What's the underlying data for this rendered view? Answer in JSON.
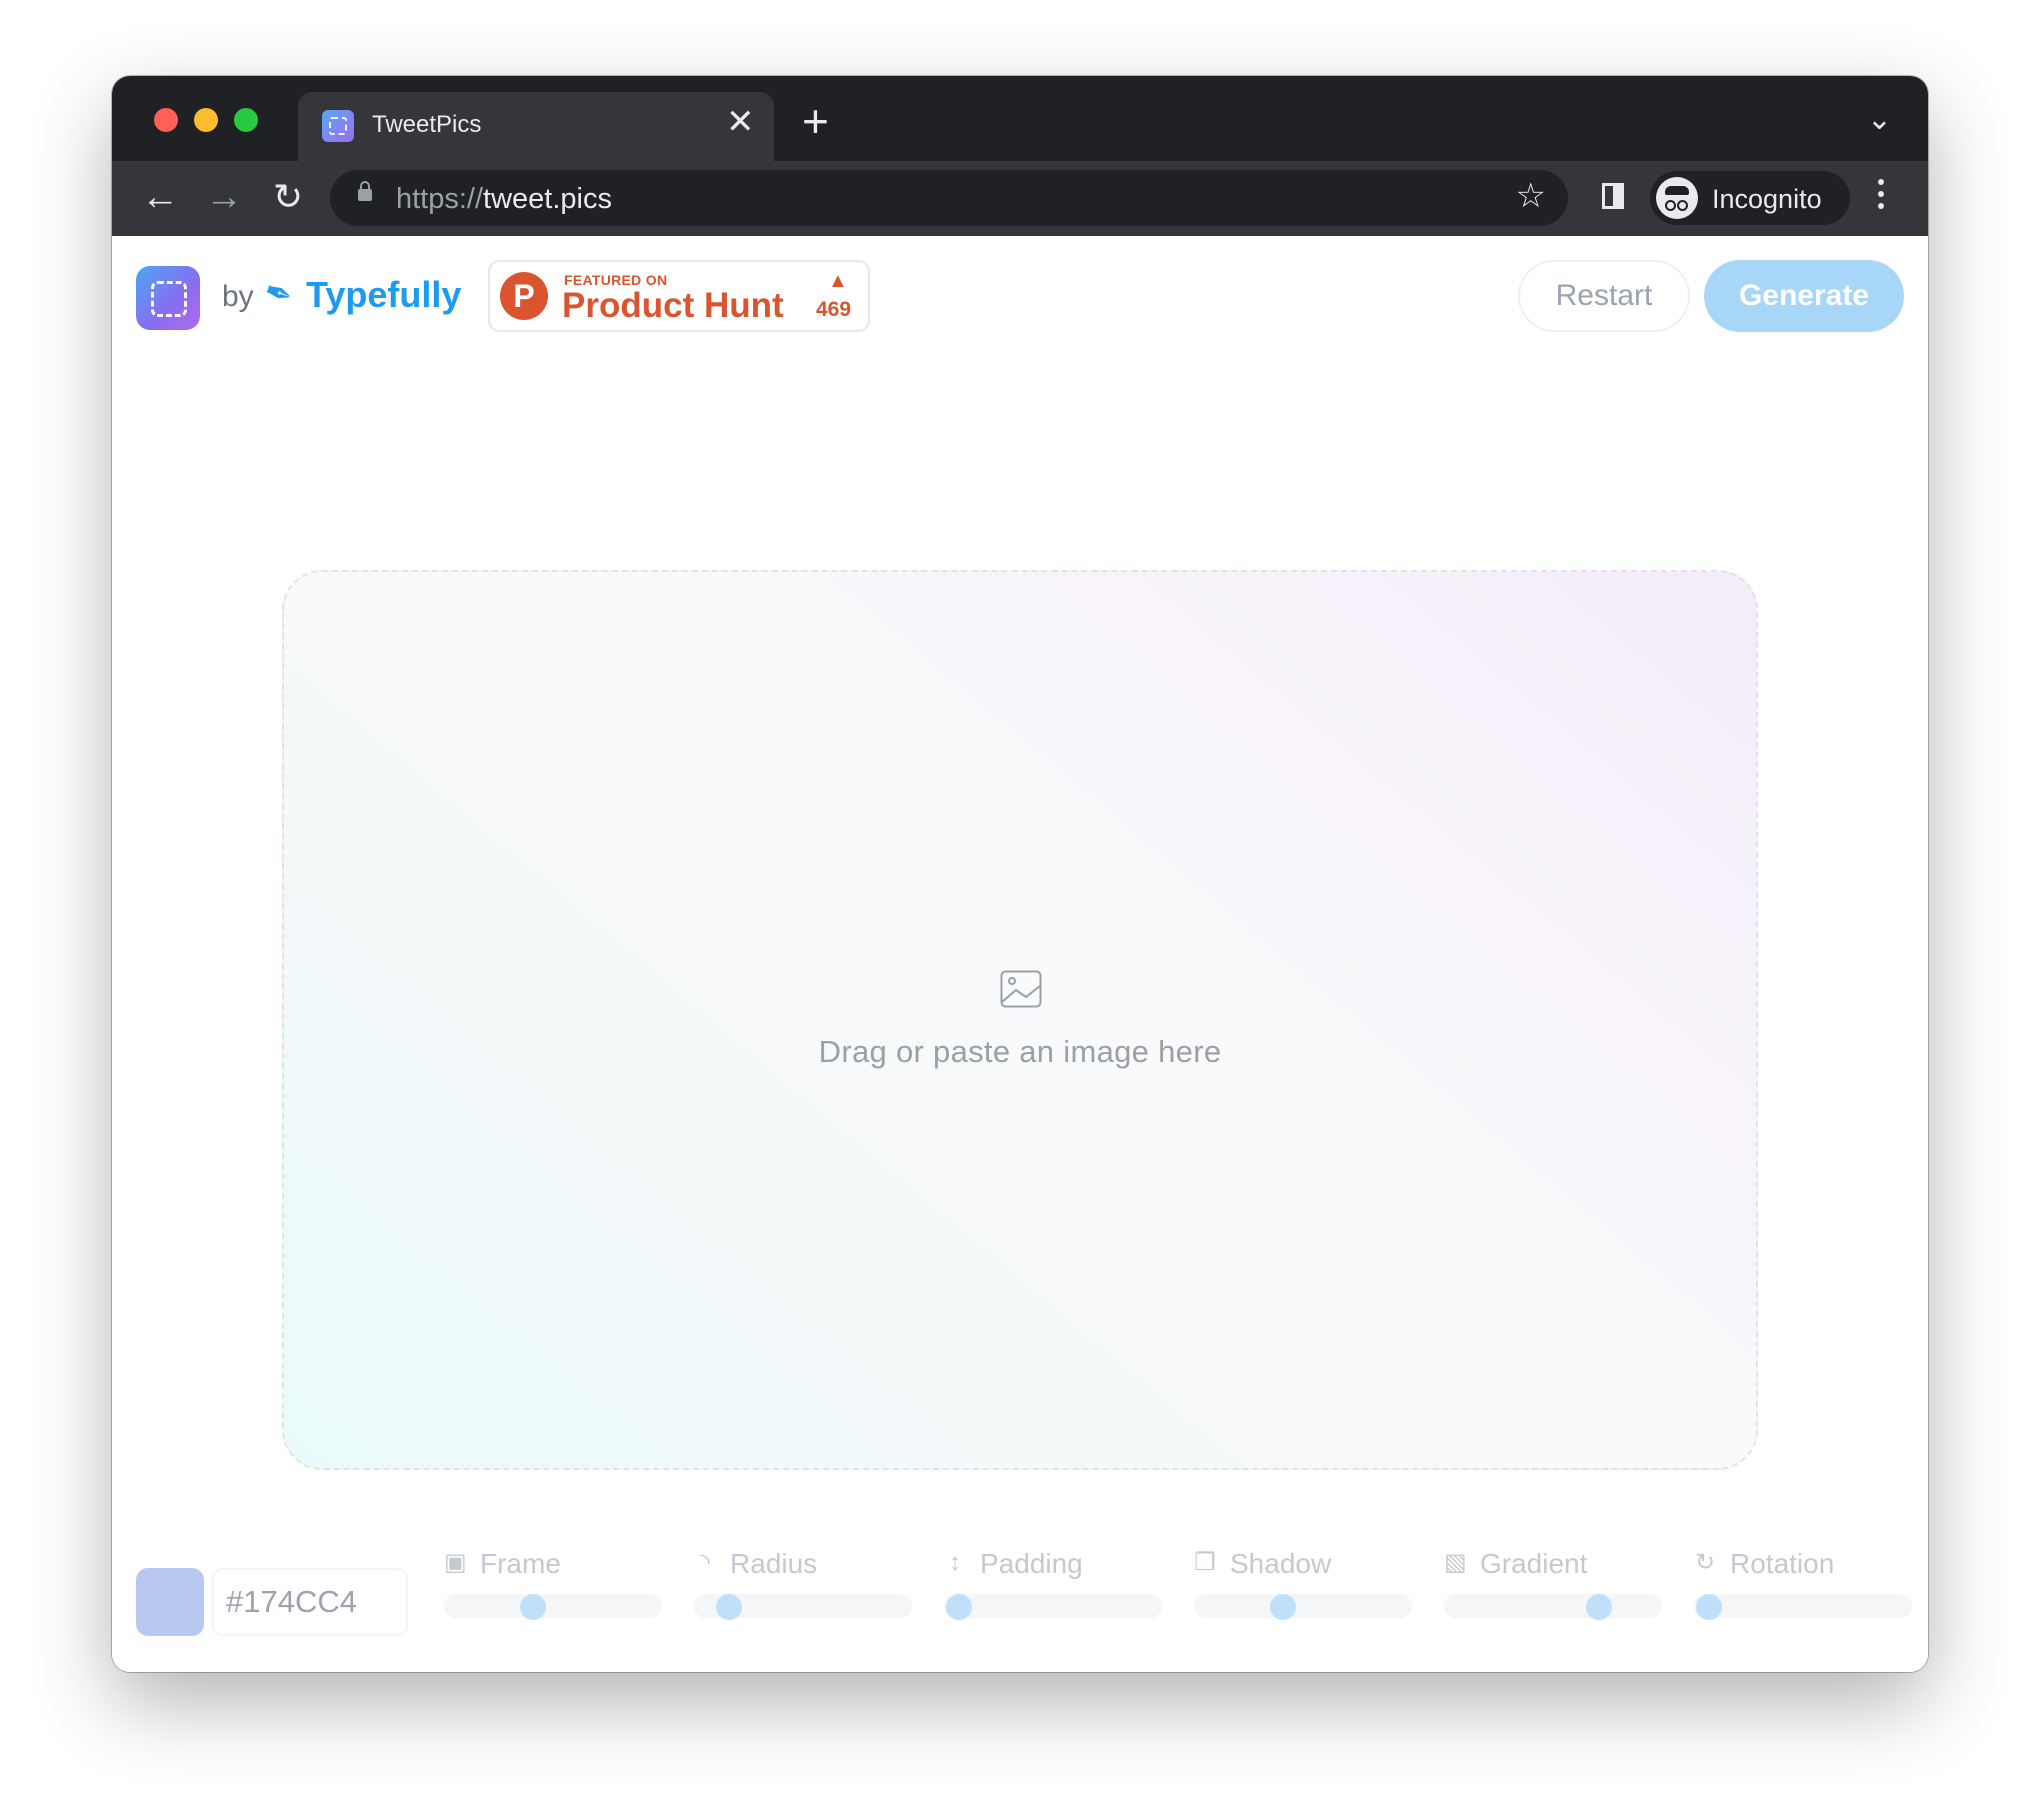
{
  "browser": {
    "tab_title": "TweetPics",
    "tab_close": "✕",
    "new_tab": "+",
    "url_scheme": "https://",
    "url_host": "tweet.pics",
    "profile_label": "Incognito"
  },
  "header": {
    "by_label": "by",
    "brand": "Typefully",
    "product_hunt": {
      "featured_label": "FEATURED ON",
      "name": "Product Hunt",
      "upvotes": "469"
    },
    "restart_label": "Restart",
    "generate_label": "Generate"
  },
  "dropzone": {
    "prompt": "Drag or paste an image here"
  },
  "controls": {
    "color_hex": "#174CC4",
    "color_swatch": "#b8c8f0",
    "sliders": [
      {
        "label": "Frame",
        "icon": "frame-icon",
        "value": 0.41
      },
      {
        "label": "Radius",
        "icon": "radius-icon",
        "value": 0.16
      },
      {
        "label": "Padding",
        "icon": "padding-icon",
        "value": 0.07
      },
      {
        "label": "Shadow",
        "icon": "shadow-icon",
        "value": 0.41
      },
      {
        "label": "Gradient",
        "icon": "gradient-icon",
        "value": 0.71
      },
      {
        "label": "Rotation",
        "icon": "rotation-icon",
        "value": 0.07
      }
    ]
  },
  "colors": {
    "accent": "#1d9bf0",
    "product_hunt": "#da552f",
    "generate_button": "#a8d6f7"
  }
}
